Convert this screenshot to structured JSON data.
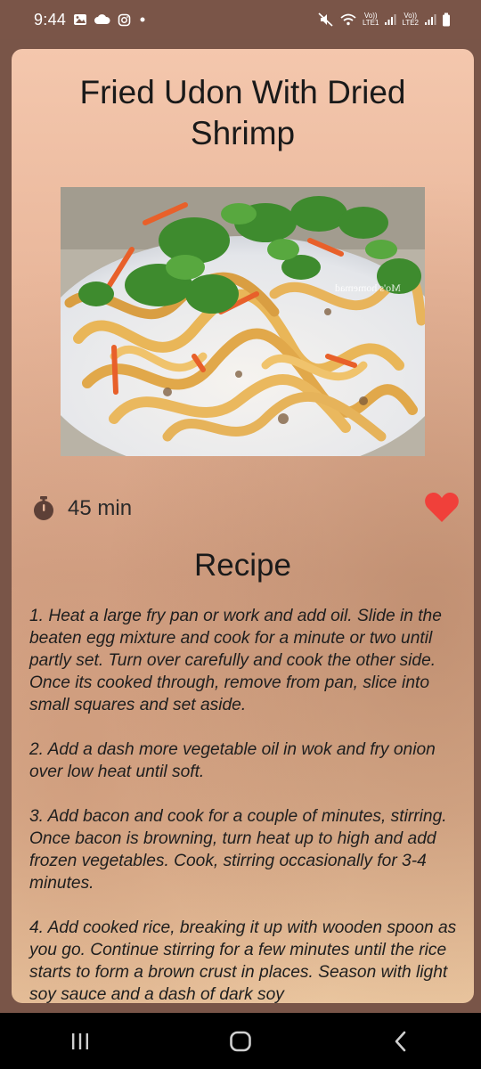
{
  "status_bar": {
    "time": "9:44",
    "left_icons": [
      "gallery-icon",
      "cloud-icon",
      "instagram-icon",
      "dot-icon"
    ],
    "right_icons": [
      "mute-icon",
      "wifi-icon",
      "signal-sim1-icon",
      "signal-sim2-icon",
      "battery-icon"
    ],
    "sim1_label_top": "Vo))",
    "sim1_label_bottom": "LTE1",
    "sim2_label_top": "Vo))",
    "sim2_label_bottom": "LTE2"
  },
  "recipe": {
    "title": "Fried Udon With Dried Shrimp",
    "image_watermark": "Mo's homemad",
    "time": "45 min",
    "favorite": true,
    "heading": "Recipe",
    "steps": [
      "1. Heat a large fry pan or work and add oil. Slide in the beaten egg mixture and cook for a minute or two until partly set. Turn over carefully and cook the other side. Once its cooked through, remove from pan, slice into small squares and set aside.",
      "2. Add a dash more vegetable oil in wok and fry onion over low heat until soft.",
      "3. Add bacon and cook for a couple of minutes, stirring. Once bacon is browning, turn heat up to high and add frozen vegetables. Cook, stirring occasionally for 3-4 minutes.",
      "4. Add cooked rice, breaking it up with wooden spoon as you go. Continue stirring for a few minutes until the rice starts to form a brown crust in places. Season with light soy sauce and a dash of dark soy"
    ]
  },
  "colors": {
    "background": "#795548",
    "heart": "#f0403a",
    "timer": "#5d4037"
  },
  "nav_bar": {
    "buttons": [
      "recent-apps-icon",
      "home-icon",
      "back-icon"
    ]
  }
}
